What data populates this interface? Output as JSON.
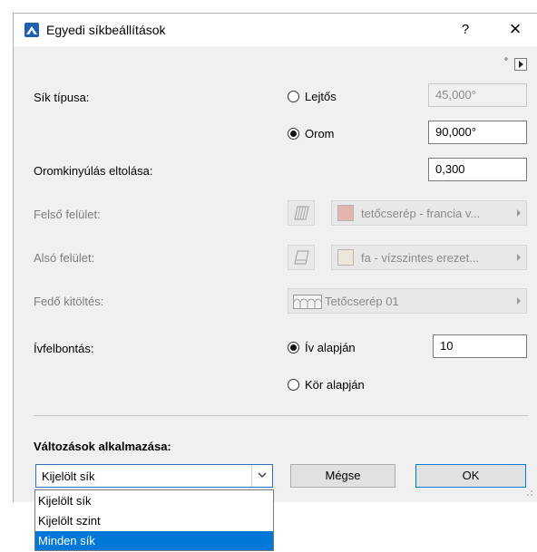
{
  "window": {
    "title": "Egyedi síkbeállítások",
    "help_label": "?",
    "close_label": "×",
    "degree_label": "°"
  },
  "plane_type": {
    "label": "Sík típusa:",
    "option_slope": {
      "label": "Lejtős",
      "value": "45,000°",
      "checked": false
    },
    "option_gable": {
      "label": "Orom",
      "value": "90,000°",
      "checked": true
    }
  },
  "gable_overhang": {
    "label": "Oromkinyúlás eltolása:",
    "value": "0,300"
  },
  "top_surface": {
    "label": "Felső felület:",
    "value": "tetőcserép - francia v...",
    "swatch_color": "#e3b5ae"
  },
  "bottom_surface": {
    "label": "Alsó felület:",
    "value": "fa - vízszintes erezet...",
    "swatch_color": "#ede6dc"
  },
  "cover_fill": {
    "label": "Fedő kitöltés:",
    "value": "Tetőcserép 01"
  },
  "arc_division": {
    "label": "Ívfelbontás:",
    "option_arc": {
      "label": "Ív alapján",
      "value": "10",
      "checked": true
    },
    "option_circle": {
      "label": "Kör alapján",
      "checked": false
    }
  },
  "apply_changes": {
    "label": "Változások alkalmazása:",
    "selected": "Kijelölt sík",
    "options": [
      "Kijelölt sík",
      "Kijelölt szint",
      "Minden sík"
    ],
    "highlighted": "Minden sík"
  },
  "buttons": {
    "cancel": "Mégse",
    "ok": "OK"
  },
  "colors": {
    "accent": "#0078d7",
    "dialog_bg": "#f0f0f0"
  }
}
